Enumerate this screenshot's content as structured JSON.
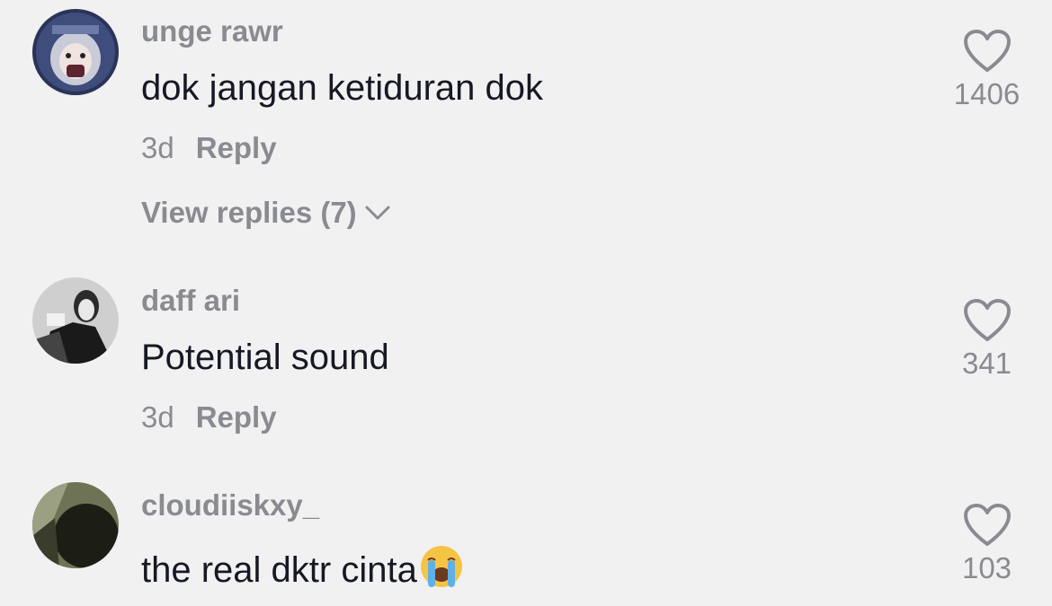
{
  "comments": [
    {
      "username": "unge rawr",
      "text": "dok jangan ketiduran dok",
      "time": "3d",
      "reply_label": "Reply",
      "view_replies": "View replies (7)",
      "likes": "1406"
    },
    {
      "username": "daff ari",
      "text": "Potential sound",
      "time": "3d",
      "reply_label": "Reply",
      "likes": "341"
    },
    {
      "username": "cloudiiskxy_",
      "text": "the real dktr cinta",
      "likes": "103"
    }
  ],
  "colors": {
    "background": "#f1f1f2",
    "text_primary": "#161823",
    "text_secondary": "#8a8b91"
  }
}
